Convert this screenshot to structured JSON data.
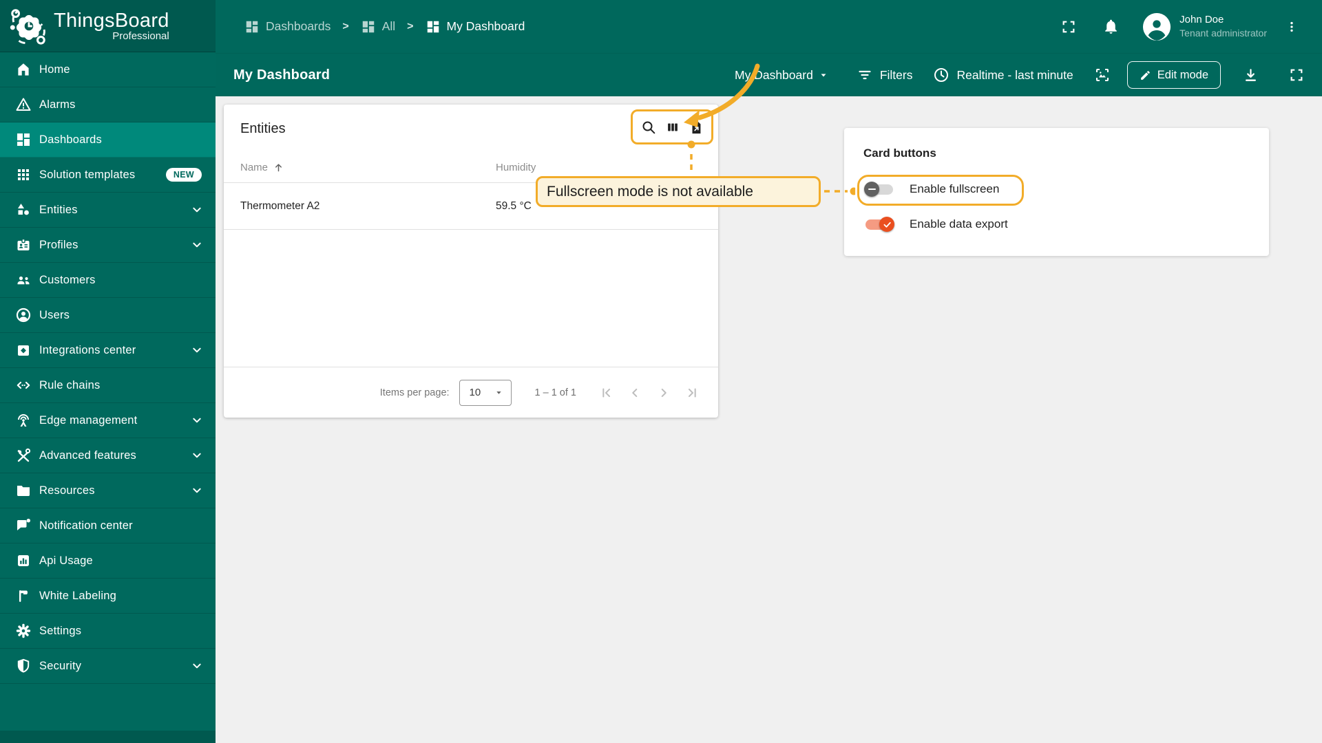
{
  "app": {
    "name": "ThingsBoard",
    "edition": "Professional"
  },
  "colors": {
    "primary_teal": "#00685C",
    "dark_teal": "#00594F",
    "selected_teal": "#00897B",
    "accent_orange": "#F2AC29",
    "tooltip_bg": "#FCF3DC",
    "toggle_on": "#EA4F1F",
    "toggle_on_track": "#F59B82",
    "toggle_off_knob": "#616161",
    "page_bg": "#F0F0F0"
  },
  "header": {
    "breadcrumb": [
      {
        "label": "Dashboards",
        "icon": "dashboard-icon"
      },
      {
        "label": "All",
        "icon": "dashboard-icon"
      },
      {
        "label": "My Dashboard",
        "icon": "dashboard-icon"
      }
    ],
    "separator": ">",
    "icons": [
      "fullscreen-icon",
      "bell-icon",
      "avatar-icon",
      "kebab-menu-icon"
    ],
    "user": {
      "name": "John Doe",
      "role": "Tenant administrator"
    }
  },
  "sidebar": {
    "items": [
      {
        "label": "Home",
        "icon": "home-icon"
      },
      {
        "label": "Alarms",
        "icon": "alarm-icon"
      },
      {
        "label": "Dashboards",
        "icon": "dashboards-icon",
        "selected": true
      },
      {
        "label": "Solution templates",
        "icon": "grid-icon",
        "badge": "NEW"
      },
      {
        "label": "Entities",
        "icon": "shapes-icon",
        "chevron": true
      },
      {
        "label": "Profiles",
        "icon": "badge-icon",
        "chevron": true
      },
      {
        "label": "Customers",
        "icon": "people-icon"
      },
      {
        "label": "Users",
        "icon": "person-icon"
      },
      {
        "label": "Integrations center",
        "icon": "integration-icon",
        "chevron": true
      },
      {
        "label": "Rule chains",
        "icon": "rule-chain-icon"
      },
      {
        "label": "Edge management",
        "icon": "antenna-icon",
        "chevron": true
      },
      {
        "label": "Advanced features",
        "icon": "tools-icon",
        "chevron": true
      },
      {
        "label": "Resources",
        "icon": "folder-icon",
        "chevron": true
      },
      {
        "label": "Notification center",
        "icon": "message-icon"
      },
      {
        "label": "Api Usage",
        "icon": "chart-icon"
      },
      {
        "label": "White Labeling",
        "icon": "flag-icon"
      },
      {
        "label": "Settings",
        "icon": "gear-icon"
      },
      {
        "label": "Security",
        "icon": "shield-icon",
        "chevron": true
      }
    ]
  },
  "toolbar": {
    "title": "My Dashboard",
    "dashboard_select": "My Dashboard",
    "filters_label": "Filters",
    "timewindow": "Realtime - last minute",
    "edit_mode_label": "Edit mode",
    "icons": [
      "filter-icon",
      "clock-icon",
      "image-icon",
      "pencil-icon",
      "download-icon",
      "fullscreen-icon"
    ]
  },
  "entities_card": {
    "title": "Entities",
    "action_icons": [
      "search-icon",
      "columns-icon",
      "export-file-icon"
    ],
    "columns": [
      {
        "label": "Name",
        "sorted": "asc"
      },
      {
        "label": "Humidity"
      }
    ],
    "rows": [
      {
        "name": "Thermometer A2",
        "humidity": "59.5 °C"
      }
    ],
    "pagination": {
      "items_per_page_label": "Items per page:",
      "items_per_page": "10",
      "range": "1 – 1 of 1",
      "icons": [
        "first-page-icon",
        "prev-page-icon",
        "next-page-icon",
        "last-page-icon"
      ]
    }
  },
  "annotation": {
    "tooltip": "Fullscreen mode is not available"
  },
  "card_buttons": {
    "title": "Card buttons",
    "toggles": [
      {
        "label": "Enable fullscreen",
        "on": false,
        "highlighted": true
      },
      {
        "label": "Enable data export",
        "on": true
      }
    ]
  }
}
